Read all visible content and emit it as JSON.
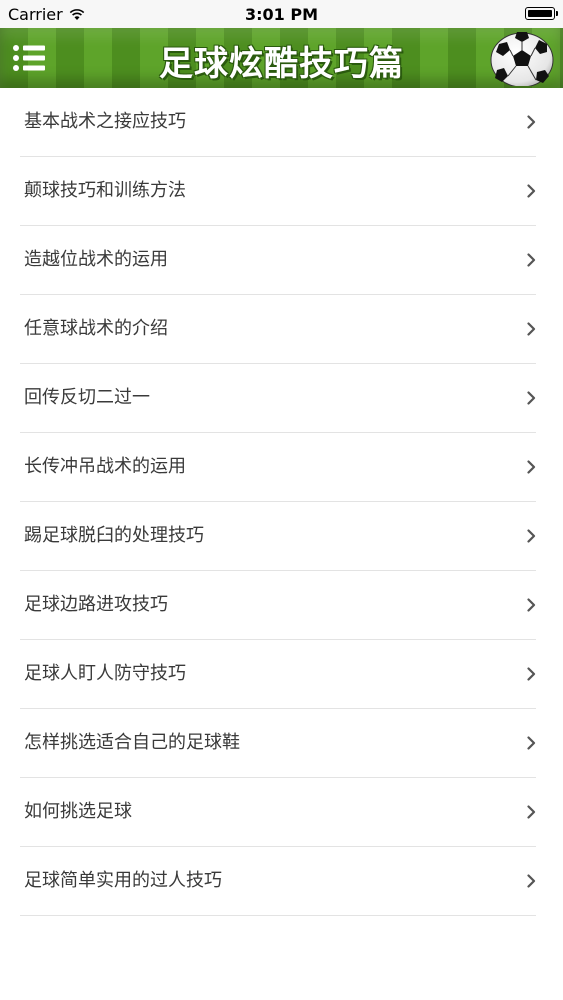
{
  "status_bar": {
    "carrier": "Carrier",
    "time": "3:01 PM"
  },
  "header": {
    "title": "足球炫酷技巧篇",
    "menu_icon": "list-menu-icon",
    "logo_icon": "soccer-ball-icon"
  },
  "list": {
    "items": [
      {
        "label": "基本战术之接应技巧"
      },
      {
        "label": "颠球技巧和训练方法"
      },
      {
        "label": "造越位战术的运用"
      },
      {
        "label": "任意球战术的介绍"
      },
      {
        "label": "回传反切二过一"
      },
      {
        "label": "长传冲吊战术的运用"
      },
      {
        "label": "踢足球脱臼的处理技巧"
      },
      {
        "label": "足球边路进攻技巧"
      },
      {
        "label": "足球人盯人防守技巧"
      },
      {
        "label": "怎样挑选适合自己的足球鞋"
      },
      {
        "label": "如何挑选足球"
      },
      {
        "label": "足球简单实用的过人技巧"
      }
    ]
  },
  "colors": {
    "header_green": "#4d8e1f",
    "separator": "#e3e3e3",
    "chevron": "#555555"
  }
}
